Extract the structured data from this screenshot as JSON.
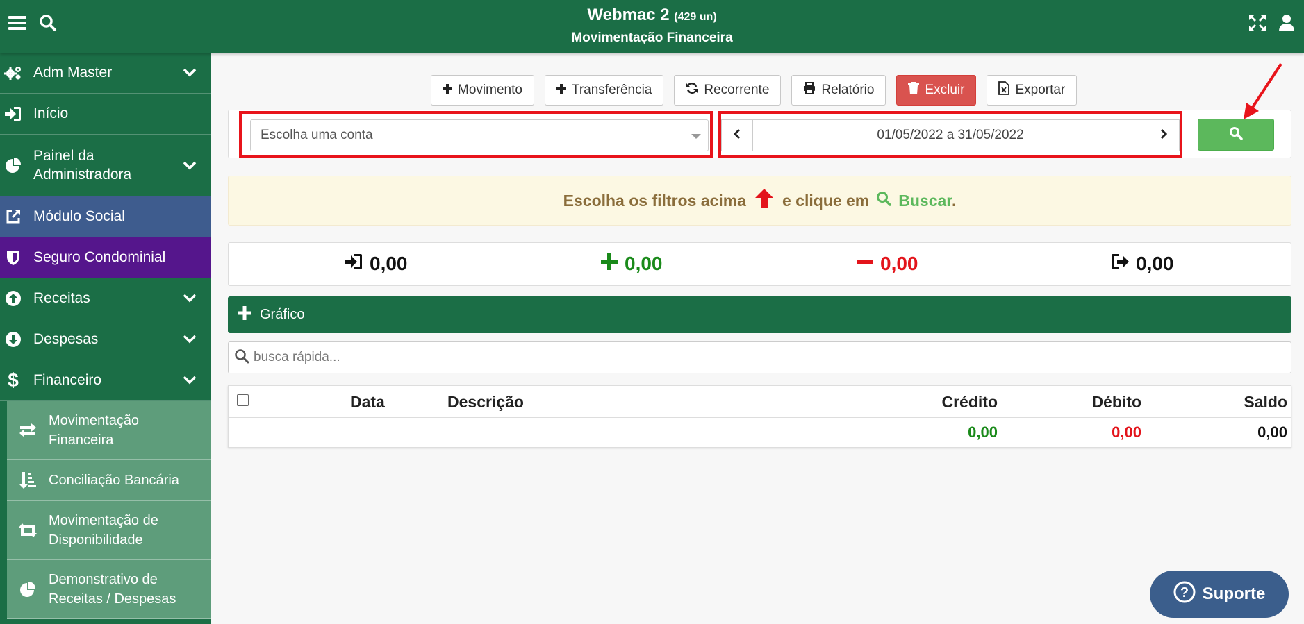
{
  "header": {
    "app_name": "Webmac 2",
    "units": "(429 un)",
    "page_title": "Movimentação Financeira"
  },
  "sidebar": {
    "items": [
      {
        "label": "Adm Master",
        "icon": "gears-icon",
        "has_children": true
      },
      {
        "label": "Início",
        "icon": "sign-in-icon",
        "has_children": false
      },
      {
        "label": "Painel da Administradora",
        "icon": "pie-chart-icon",
        "has_children": true
      },
      {
        "label": "Módulo Social",
        "icon": "external-link-icon",
        "has_children": false,
        "color": "#3e5c8e"
      },
      {
        "label": "Seguro Condominial",
        "icon": "shield-icon",
        "has_children": false,
        "color": "#55168c"
      },
      {
        "label": "Receitas",
        "icon": "arrow-circle-up-icon",
        "has_children": true
      },
      {
        "label": "Despesas",
        "icon": "arrow-circle-down-icon",
        "has_children": true
      },
      {
        "label": "Financeiro",
        "icon": "dollar-icon",
        "has_children": true
      }
    ],
    "submenu": [
      {
        "label": "Movimentação Financeira",
        "icon": "exchange-icon"
      },
      {
        "label": "Conciliação Bancária",
        "icon": "sort-amount-icon"
      },
      {
        "label": "Movimentação de Disponibilidade",
        "icon": "retweet-icon"
      },
      {
        "label": "Demonstrativo de Receitas / Despesas",
        "icon": "pie-chart-icon"
      }
    ]
  },
  "toolbar": {
    "movimento": "Movimento",
    "transferencia": "Transferência",
    "recorrente": "Recorrente",
    "relatorio": "Relatório",
    "excluir": "Excluir",
    "exportar": "Exportar"
  },
  "filters": {
    "account_placeholder": "Escolha uma conta",
    "date_range": "01/05/2022 a 31/05/2022"
  },
  "notice": {
    "text_before": "Escolha os filtros acima",
    "text_middle": "e clique em",
    "buscar": "Buscar",
    "period": "."
  },
  "totals": {
    "opening": "0,00",
    "credits": "0,00",
    "debits": "0,00",
    "closing": "0,00"
  },
  "chart_panel": {
    "label": "Gráfico"
  },
  "quick_search": {
    "placeholder": "busca rápida..."
  },
  "table": {
    "columns": [
      "Data",
      "Descrição",
      "Crédito",
      "Débito",
      "Saldo"
    ],
    "footer": {
      "credito": "0,00",
      "debito": "0,00",
      "saldo": "0,00"
    }
  },
  "support": {
    "label": "Suporte"
  },
  "colors": {
    "brand_green": "#1b6e46",
    "success": "#5cb85c",
    "danger": "#d9534f",
    "annotation_red": "#e8141b",
    "credit_green": "#1a8a1a",
    "debit_red": "#e3141b"
  }
}
